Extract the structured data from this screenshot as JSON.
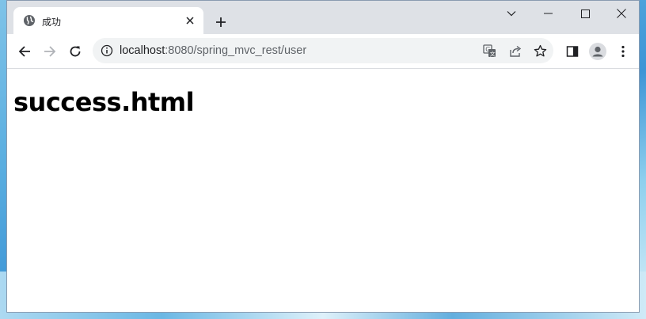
{
  "browser": {
    "tab": {
      "title": "成功",
      "favicon_icon": "globe-icon",
      "close_icon": "close-icon"
    },
    "new_tab_icon": "plus-icon",
    "window_controls": [
      "chevron-down-icon",
      "minimize-icon",
      "maximize-icon",
      "close-icon"
    ],
    "toolbar": {
      "back_icon": "arrow-left-icon",
      "forward_icon": "arrow-right-icon",
      "reload_icon": "reload-icon",
      "address": {
        "info_icon": "info-icon",
        "host": "localhost",
        "path": ":8080/spring_mvc_rest/user"
      },
      "omnibox_icons": [
        "translate-icon",
        "share-icon",
        "star-icon"
      ],
      "side_panel_icon": "side-panel-icon",
      "profile_icon": "profile-icon",
      "menu_icon": "more-vert-icon"
    }
  },
  "page": {
    "heading": "success.html"
  },
  "colors": {
    "tabstrip": "#dee1e6",
    "omnibox": "#f1f3f4",
    "icon": "#5f6368"
  }
}
